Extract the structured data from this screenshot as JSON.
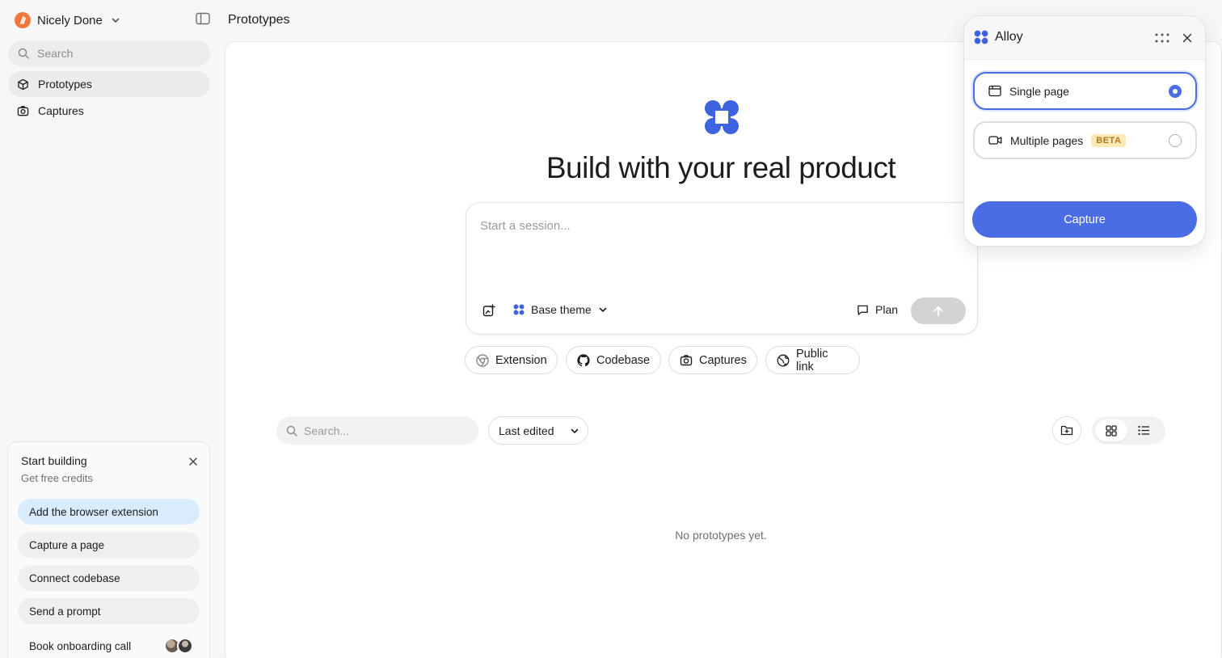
{
  "sidebar": {
    "workspace_name": "Nicely Done",
    "search_placeholder": "Search",
    "nav": [
      {
        "label": "Prototypes",
        "icon": "cube-icon",
        "active": true
      },
      {
        "label": "Captures",
        "icon": "camera-icon",
        "active": false
      }
    ],
    "onboarding": {
      "title": "Start building",
      "subtitle": "Get free credits",
      "steps": [
        {
          "label": "Add the browser extension",
          "highlighted": true
        },
        {
          "label": "Capture a page"
        },
        {
          "label": "Connect codebase"
        },
        {
          "label": "Send a prompt"
        },
        {
          "label": "Book onboarding call"
        }
      ]
    }
  },
  "header": {
    "title": "Prototypes"
  },
  "main": {
    "hero_title": "Build with your real product",
    "composer": {
      "placeholder": "Start a session...",
      "theme_label": "Base theme",
      "plan_label": "Plan"
    },
    "chips": [
      {
        "label": "Extension",
        "icon": "chrome-icon"
      },
      {
        "label": "Codebase",
        "icon": "github-icon"
      },
      {
        "label": "Captures",
        "icon": "camera-icon"
      },
      {
        "label": "Public link",
        "icon": "globe-icon"
      }
    ],
    "list": {
      "search_placeholder": "Search...",
      "sort_value": "Last edited",
      "view_mode": "grid",
      "empty_text": "No prototypes yet."
    }
  },
  "popup": {
    "title": "Alloy",
    "options": [
      {
        "label": "Single page",
        "selected": true,
        "icon": "browser-window-icon"
      },
      {
        "label": "Multiple pages",
        "badge": "BETA",
        "selected": false,
        "icon": "video-icon"
      }
    ],
    "capture_label": "Capture"
  },
  "colors": {
    "accent": "#4a6de5",
    "workspace_logo": "#f0763a",
    "beta_bg": "#fde9b5",
    "beta_text": "#b5781c",
    "highlight_step": "#d9ecfd"
  }
}
